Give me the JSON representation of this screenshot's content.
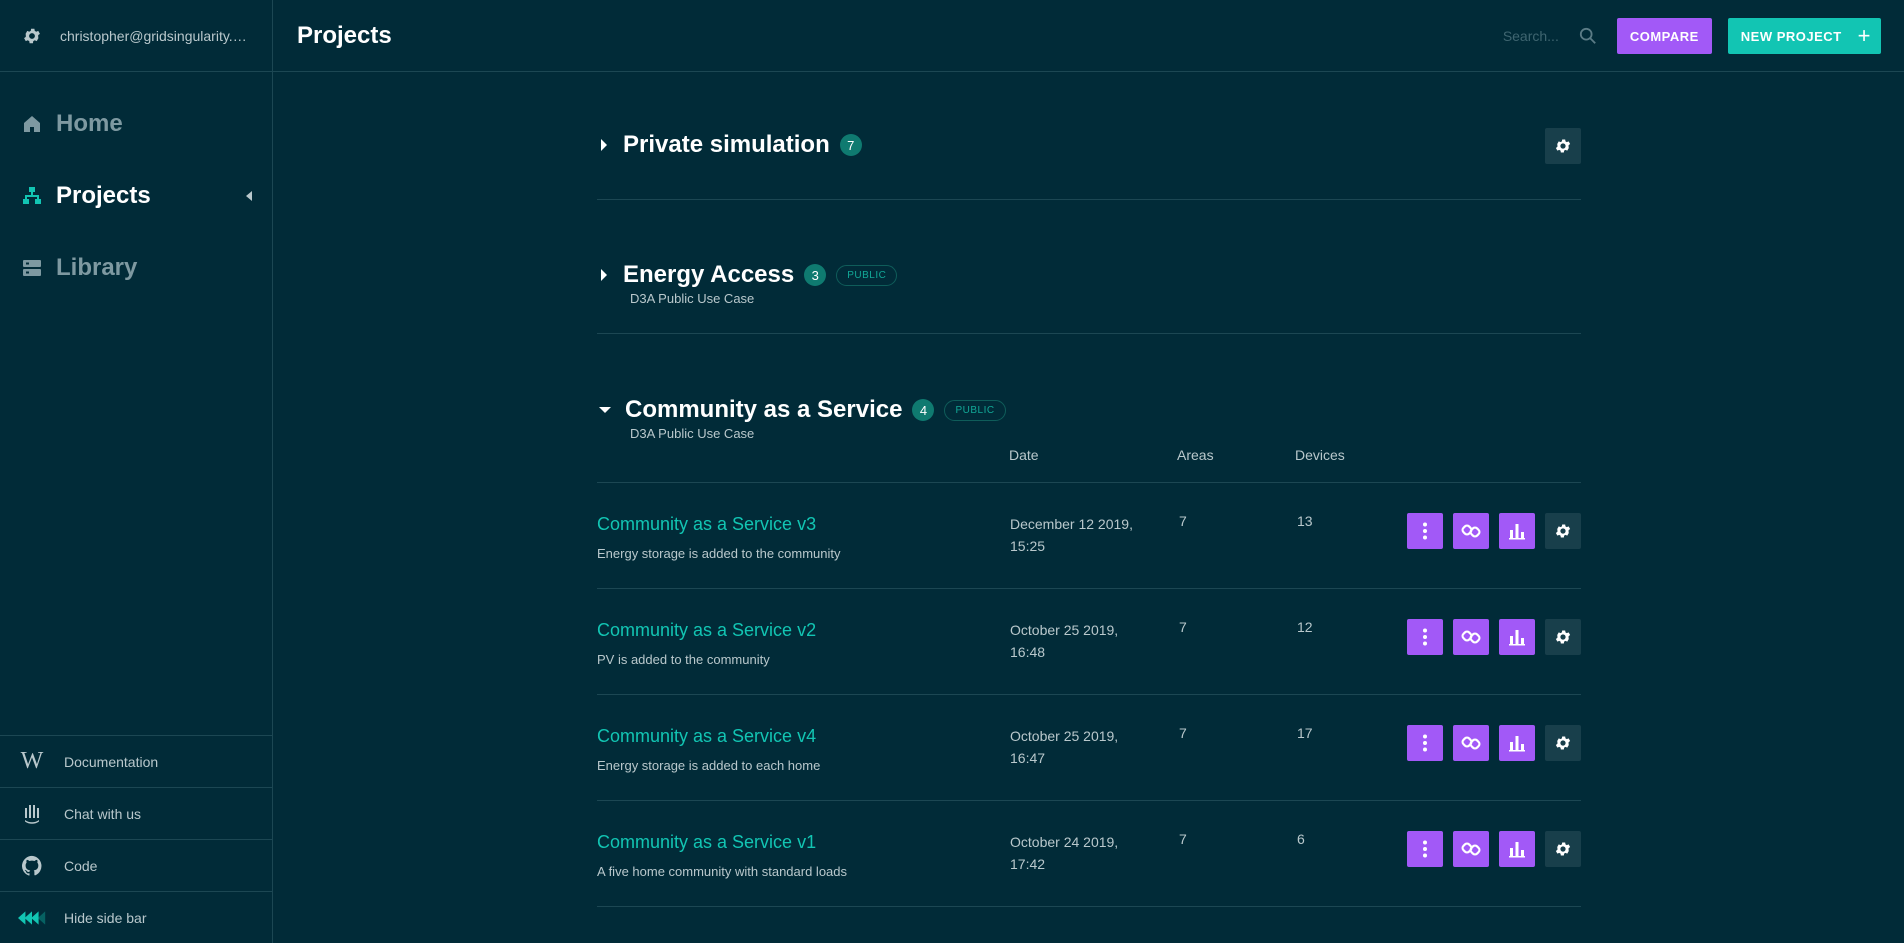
{
  "user": {
    "email": "christopher@gridsingularity.com"
  },
  "nav": [
    {
      "label": "Home",
      "icon": "home-icon",
      "active": false
    },
    {
      "label": "Projects",
      "icon": "projects-icon",
      "active": true
    },
    {
      "label": "Library",
      "icon": "library-icon",
      "active": false
    }
  ],
  "bottom_links": {
    "documentation": "Documentation",
    "chat": "Chat with us",
    "code": "Code",
    "hide": "Hide side bar"
  },
  "header": {
    "title": "Projects",
    "search_placeholder": "Search...",
    "compare_label": "COMPARE",
    "new_project_label": "NEW PROJECT"
  },
  "sections": [
    {
      "title": "Private simulation",
      "count": "7",
      "public": false,
      "subtitle": ""
    },
    {
      "title": "Energy Access",
      "count": "3",
      "public": true,
      "public_label": "PUBLIC",
      "subtitle": "D3A Public Use Case"
    },
    {
      "title": "Community as a Service",
      "count": "4",
      "public": true,
      "public_label": "PUBLIC",
      "subtitle": "D3A Public Use Case",
      "expanded": true
    }
  ],
  "table": {
    "columns": {
      "date": "Date",
      "areas": "Areas",
      "devices": "Devices"
    },
    "rows": [
      {
        "name": "Community as a Service v3",
        "description": "Energy storage is added to the community",
        "date": "December 12 2019, 15:25",
        "areas": "7",
        "devices": "13"
      },
      {
        "name": "Community as a Service v2",
        "description": "PV is added to the community",
        "date": "October 25 2019, 16:48",
        "areas": "7",
        "devices": "12"
      },
      {
        "name": "Community as a Service v4",
        "description": "Energy storage is added to each home",
        "date": "October 25 2019, 16:47",
        "areas": "7",
        "devices": "17"
      },
      {
        "name": "Community as a Service v1",
        "description": "A five home community with standard loads",
        "date": "October 24 2019, 17:42",
        "areas": "7",
        "devices": "6"
      }
    ]
  },
  "colors": {
    "background": "#012b38",
    "accent_teal": "#12c5b3",
    "accent_purple": "#a259f7"
  }
}
